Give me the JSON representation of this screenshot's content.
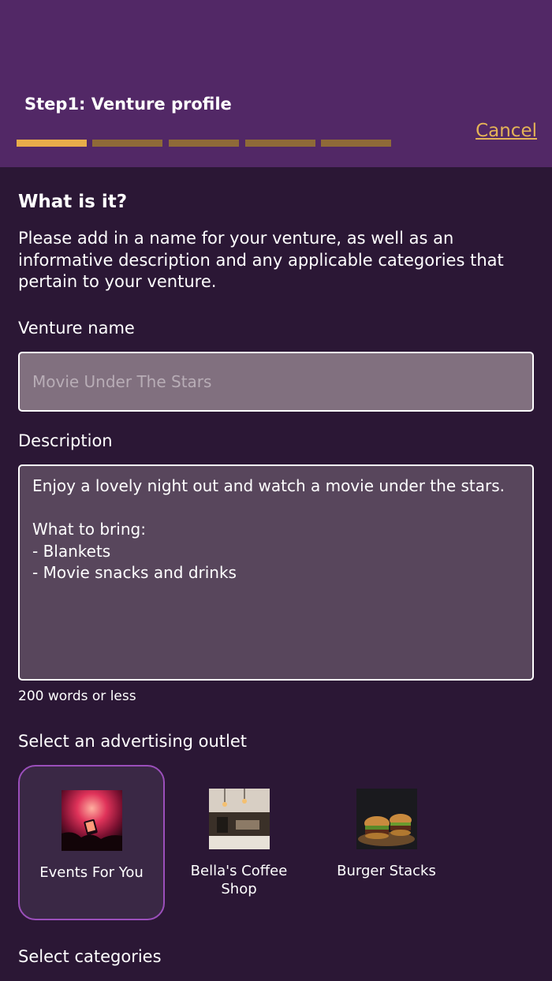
{
  "header": {
    "step_title": "Step1: Venture profile",
    "cancel_label": "Cancel",
    "progress": {
      "total_steps": 5,
      "current_step": 1
    },
    "colors": {
      "active": "#e8ac4a",
      "inactive": "#8f6a38"
    }
  },
  "intro": {
    "heading": "What is it?",
    "text": "Please add in a name for your venture, as well as an informative description and any applicable categories that pertain to your venture."
  },
  "venture_name": {
    "label": "Venture name",
    "placeholder": "Movie Under The Stars"
  },
  "description": {
    "label": "Description",
    "value": "Enjoy a lovely night out and watch a movie under the stars.\n\nWhat to bring:\n- Blankets\n- Movie snacks and drinks",
    "hint": "200 words or less"
  },
  "outlets": {
    "label": "Select an advertising outlet",
    "items": [
      {
        "name": "Events For You",
        "selected": true,
        "image": "concert-photo"
      },
      {
        "name": "Bella's Coffee Shop",
        "selected": false,
        "image": "coffee-shop-photo"
      },
      {
        "name": "Burger Stacks",
        "selected": false,
        "image": "burger-photo"
      }
    ]
  },
  "categories": {
    "label": "Select categories"
  }
}
